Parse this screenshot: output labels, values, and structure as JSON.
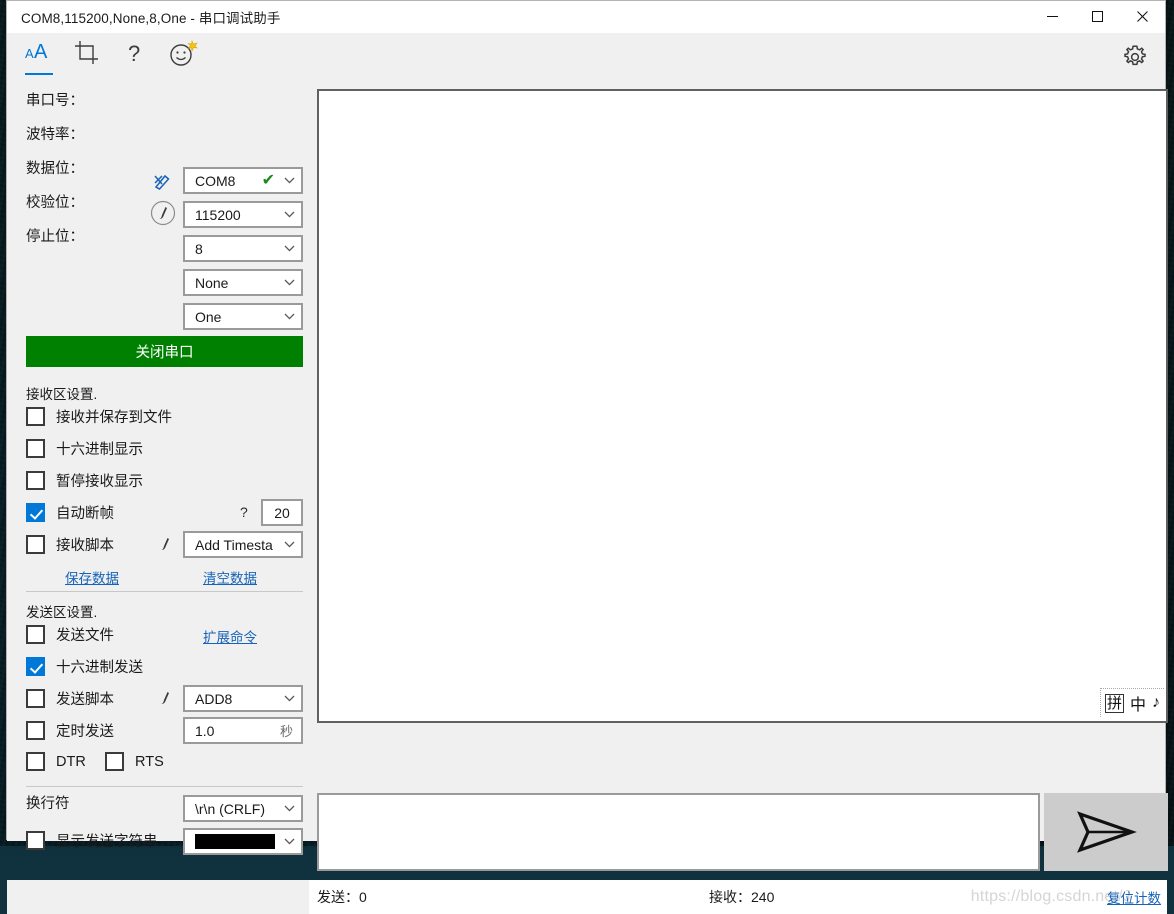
{
  "window": {
    "title": "COM8,115200,None,8,One  -  串口调试助手",
    "minimize_label": "minimize",
    "maximize_label": "maximize",
    "close_label": "close"
  },
  "toolbar": {
    "items": [
      {
        "name": "font-size-icon",
        "label": "AA"
      },
      {
        "name": "crop-icon",
        "label": "crop"
      },
      {
        "name": "help-icon",
        "label": "?"
      },
      {
        "name": "smiley-icon",
        "label": "smiley"
      }
    ],
    "settings_label": "gear-icon"
  },
  "port_settings": {
    "fields": [
      {
        "label": "串口号：",
        "value": "COM8",
        "connected": true
      },
      {
        "label": "波特率：",
        "value": "115200",
        "connected": false
      },
      {
        "label": "数据位：",
        "value": "8",
        "connected": false
      },
      {
        "label": "校验位：",
        "value": "None",
        "connected": false
      },
      {
        "label": "停止位：",
        "value": "One",
        "connected": false
      }
    ],
    "toggle_button": "关闭串口"
  },
  "receive_settings": {
    "title": "接收区设置.",
    "checkboxes": [
      {
        "label": "接收并保存到文件",
        "checked": false
      },
      {
        "label": "十六进制显示",
        "checked": false
      },
      {
        "label": "暂停接收显示",
        "checked": false
      },
      {
        "label": "自动断帧",
        "checked": true
      },
      {
        "label": "接收脚本",
        "checked": false
      }
    ],
    "frame_help": "?",
    "frame_timeout": "20",
    "script_value": "Add Timesta",
    "save_link": "保存数据",
    "clear_link": "清空数据"
  },
  "send_settings": {
    "title": "发送区设置.",
    "checkboxes": [
      {
        "label": "发送文件",
        "checked": false
      },
      {
        "label": "十六进制发送",
        "checked": true
      },
      {
        "label": "发送脚本",
        "checked": false
      },
      {
        "label": "定时发送",
        "checked": false
      },
      {
        "label": "DTR",
        "checked": false
      },
      {
        "label": "RTS",
        "checked": false
      }
    ],
    "extend_link": "扩展命令",
    "script_value": "ADD8",
    "interval_value": "1.0",
    "interval_unit": "秒"
  },
  "newline_settings": {
    "label": "换行符",
    "value": "\\r\\n (CRLF)",
    "show_string_label": "显示发送字符串",
    "show_string_checked": false,
    "color_value": "#000000"
  },
  "receive_area": {
    "content": "",
    "ime": {
      "mode_box": "拼",
      "language": "中",
      "extra": "♪"
    }
  },
  "send_area": {
    "content": "",
    "placeholder": "",
    "send_icon": "send-arrow-icon"
  },
  "status_bar": {
    "sent_label": "发送：0",
    "received_label": "接收：240",
    "watermark": "https://blog.csdn.net/J",
    "reset_link": "复位计数"
  }
}
